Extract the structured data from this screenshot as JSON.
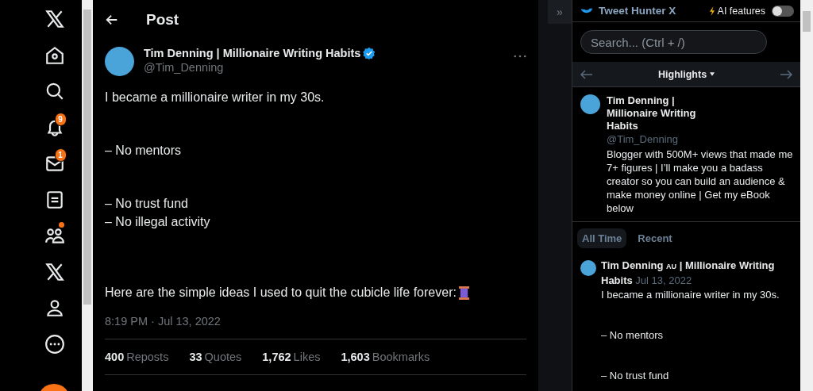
{
  "nav": {
    "items": [
      {
        "dot": false
      },
      {
        "dot": false
      },
      {
        "dot": false
      },
      {
        "dot": false,
        "badge": "9"
      },
      {
        "dot": false,
        "badge": "1"
      },
      {
        "dot": false
      },
      {
        "dot": true
      },
      {
        "dot": false
      },
      {
        "dot": false
      },
      {
        "dot": false
      }
    ]
  },
  "post": {
    "header": "Post",
    "author": "Tim Denning | Millionaire Writing Habits",
    "verified": true,
    "handle": "@Tim_Denning",
    "paragraphs": [
      {
        "text": "I became a millionaire writer in my 30s.",
        "spool": false
      },
      {
        "text": "– No mentors",
        "spool": false
      },
      {
        "text": "– No trust fund",
        "spool": false
      },
      {
        "text": "– No illegal activity",
        "spool": false
      },
      {
        "text": "Here are the simple ideas I used to quit the cubicle life forever:",
        "spool": true
      }
    ],
    "timestamp": "8:19 PM · Jul 13, 2022",
    "stats": [
      {
        "count": "400",
        "noun": "Reposts"
      },
      {
        "count": "33",
        "noun": "Quotes"
      },
      {
        "count": "1,762",
        "noun": "Likes"
      },
      {
        "count": "1,603",
        "noun": "Bookmarks"
      }
    ]
  },
  "panel": {
    "collapse": "»",
    "brand": "Tweet Hunter X",
    "ai_label": "AI features",
    "ai_on": false,
    "search": {
      "placeholder": "Search... (Ctrl + /)"
    },
    "section": "Highlights",
    "profile": {
      "name_lines": [
        "Tim Denning |",
        "Millionaire Writing",
        "Habits"
      ],
      "handle": "@Tim_Denning",
      "bio": "Blogger with 500M+ views that made me 7+ figures | I’ll make you a badass creator so you can build an audience & make money online | Get my eBook below"
    },
    "tabs": [
      {
        "label": "All Time",
        "selected": true
      },
      {
        "label": "Recent",
        "selected": false
      }
    ],
    "tweet": {
      "name": "Tim Denning",
      "flag": "AU",
      "name_rest": "| Millionaire Writing",
      "name_end": "Habits",
      "date": "Jul 13, 2022",
      "lines": [
        "I became a millionaire writer in my 30s.",
        "– No mentors",
        "– No trust fund"
      ]
    }
  }
}
